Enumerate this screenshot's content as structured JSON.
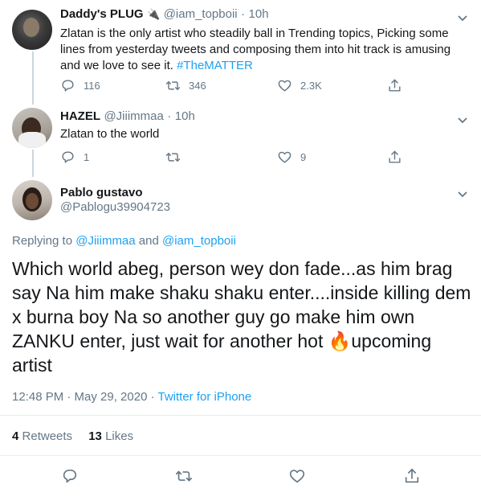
{
  "tweet1": {
    "name": "Daddy's PLUG",
    "plug_emoji": "🔌",
    "handle": "@iam_topboii",
    "dot": "·",
    "time": "10h",
    "text_line1": "Zlatan is the only artist who steadily ball in Trending topics, Picking some",
    "text_line2": "lines from yesterday tweets and composing them into hit track is amusing",
    "text_line3a": "and we love to see it. ",
    "hashtag": "#TheMATTER",
    "replies": "116",
    "retweets": "346",
    "likes": "2.3K"
  },
  "tweet2": {
    "name": "HAZEL",
    "handle": "@Jiiimmaa",
    "dot": "·",
    "time": "10h",
    "text": "Zlatan to the world",
    "replies": "1",
    "retweets": "",
    "likes": "9"
  },
  "main": {
    "name": "Pablo gustavo",
    "handle": "@Pablogu39904723",
    "replying_prefix": "Replying to ",
    "reply_to_1": "@Jiiimmaa",
    "reply_and": " and ",
    "reply_to_2": "@iam_topboii",
    "text_line1": "Which world abeg, person wey don fade...as him brag",
    "text_line2": "say Na him make shaku shaku enter....inside killing dem",
    "text_line3": "x burna boy Na so another guy go make him own",
    "text_line4a": "ZANKU enter, just wait for another hot ",
    "fire_emoji": "🔥",
    "text_line4b": "upcoming",
    "text_line5": "artist",
    "timestamp": "12:48 PM · May 29, 2020 · ",
    "client": "Twitter for iPhone",
    "retweets_count": "4",
    "retweets_label": "Retweets",
    "likes_count": "13",
    "likes_label": "Likes"
  },
  "colors": {
    "accent": "#1da1f2",
    "muted": "#657786",
    "text": "#14171a",
    "divider": "#e6ecf0"
  },
  "icons": [
    "more-chevron-icon",
    "reply-icon",
    "retweet-icon",
    "like-icon",
    "share-icon"
  ]
}
